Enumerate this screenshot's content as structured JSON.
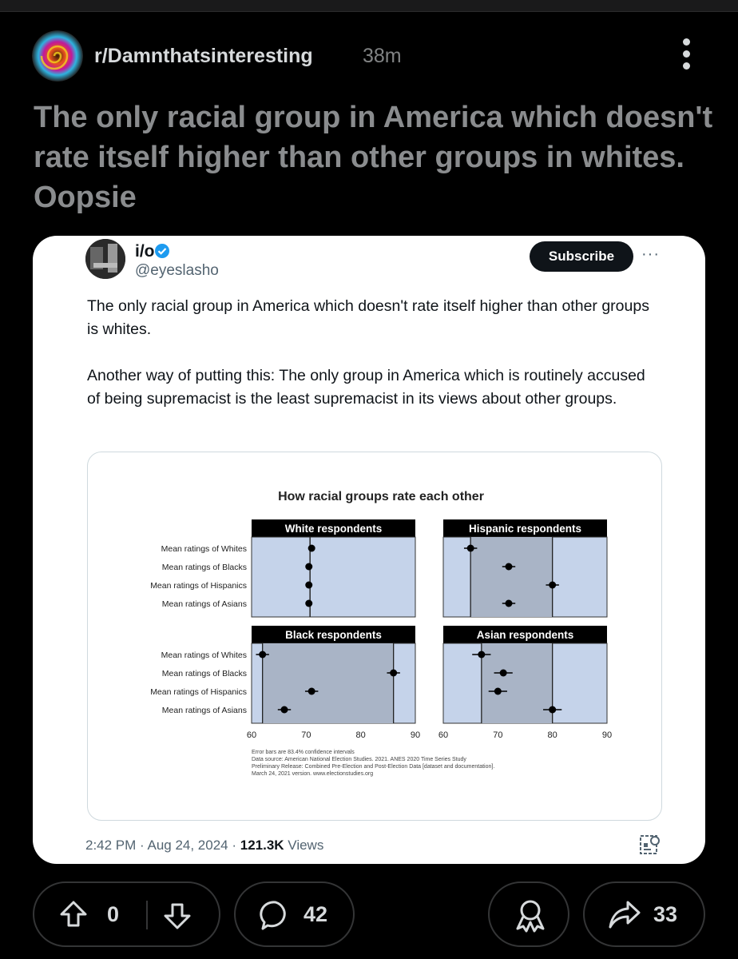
{
  "post": {
    "subreddit": "r/Damnthatsinteresting",
    "time": "38m",
    "title": "The only racial group in America which doesn't rate itself higher than other groups in whites. Oopsie"
  },
  "tweet": {
    "name": "i/o",
    "handle": "@eyeslasho",
    "subscribe_label": "Subscribe",
    "more_label": "···",
    "paragraph1": "The only racial group in America which doesn't rate itself higher than other groups is whites.",
    "paragraph2": "Another way of putting this: The only group in America which is routinely accused of being supremacist is the least supremacist in its views about other groups.",
    "timestamp": "2:42 PM · Aug 24, 2024 · ",
    "views_count": "121.3K",
    "views_label": " Views"
  },
  "chart_data": {
    "type": "scatter",
    "title": "How racial groups rate each other",
    "rows": [
      "Mean ratings of Whites",
      "Mean ratings of Blacks",
      "Mean ratings of Hispanics",
      "Mean ratings of Asians"
    ],
    "xlim": [
      60,
      90
    ],
    "xticks": [
      60,
      70,
      80,
      90
    ],
    "panels": [
      {
        "name": "White respondents",
        "values": [
          71,
          70.5,
          70.5,
          70.5
        ],
        "range": [
          70.7,
          70.7
        ],
        "err": [
          0.4,
          0.4,
          0.4,
          0.4
        ]
      },
      {
        "name": "Hispanic respondents",
        "values": [
          65,
          72,
          80,
          72
        ],
        "range": [
          65,
          80
        ],
        "err": [
          1.2,
          1.2,
          1.2,
          1.2
        ]
      },
      {
        "name": "Black respondents",
        "values": [
          62,
          86,
          71,
          66
        ],
        "range": [
          62,
          86
        ],
        "err": [
          1.2,
          1.2,
          1.2,
          1.2
        ]
      },
      {
        "name": "Asian respondents",
        "values": [
          67,
          71,
          70,
          80
        ],
        "range": [
          67,
          80
        ],
        "err": [
          1.7,
          1.7,
          1.7,
          1.7
        ]
      }
    ],
    "footnote": [
      "Error bars are 83.4% confidence intervals",
      "Data source: American National Election Studies. 2021. ANES 2020 Time Series Study",
      "Preliminary Release: Combined Pre-Election and Post-Election Data [dataset and documentation].",
      "March 24, 2021 version. www.electionstudies.org"
    ],
    "colors": {
      "panel_bg": "#c5d3ea",
      "shaded": "#a9b4c6",
      "header_bg": "#000000",
      "point": "#000000"
    }
  },
  "actions": {
    "upvotes": "0",
    "comments": "42",
    "shares": "33"
  },
  "colors": {
    "background": "#000000",
    "title_text": "#8a8c8e",
    "card_bg": "#ffffff",
    "verified": "#1d9bf0"
  }
}
